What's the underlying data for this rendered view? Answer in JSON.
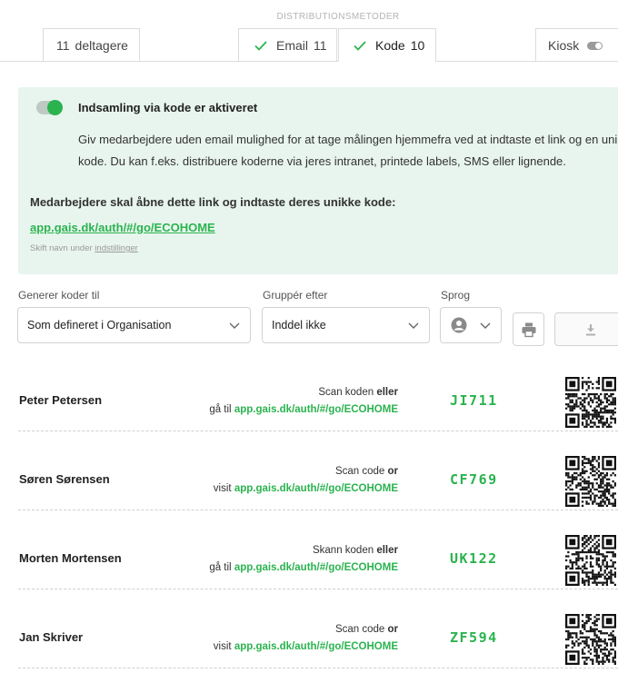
{
  "distribution": {
    "label": "DISTRIBUTIONSMETODER",
    "tabs": [
      {
        "label": "deltagere",
        "count": "11"
      },
      {
        "label": "Email",
        "count": "11"
      },
      {
        "label": "Kode",
        "count": "10"
      },
      {
        "label": "Kiosk"
      }
    ]
  },
  "panel": {
    "title": "Indsamling via kode er aktiveret",
    "description": "Giv medarbejdere uden email mulighed for at tage målingen hjemmefra ved at indtaste et link og en unik kode. Du kan f.eks. distribuere koderne via jeres intranet, printede labels, SMS eller lignende.",
    "instruction": "Medarbejdere skal åbne dette link og indtaste deres unikke kode:",
    "link": "app.gais.dk/auth/#/go/ECOHOME",
    "note_prefix": "Skift navn under",
    "note_link": "indstillinger"
  },
  "filters": {
    "generate_label": "Generer koder til",
    "generate_value": "Som defineret i Organisation",
    "group_label": "Gruppér efter",
    "group_value": "Inddel ikke",
    "language_label": "Sprog"
  },
  "people": [
    {
      "name": "Peter Petersen",
      "scan": "Scan koden",
      "or": "eller",
      "visit": "gå til",
      "url": "app.gais.dk/auth/#/go/ECOHOME",
      "code": "JI711"
    },
    {
      "name": "Søren Sørensen",
      "scan": "Scan code",
      "or": "or",
      "visit": "visit",
      "url": "app.gais.dk/auth/#/go/ECOHOME",
      "code": "CF769"
    },
    {
      "name": "Morten Mortensen",
      "scan": "Skann koden",
      "or": "eller",
      "visit": "gå til",
      "url": "app.gais.dk/auth/#/go/ECOHOME",
      "code": "UK122"
    },
    {
      "name": "Jan Skriver",
      "scan": "Scan code",
      "or": "or",
      "visit": "visit",
      "url": "app.gais.dk/auth/#/go/ECOHOME",
      "code": "ZF594"
    }
  ],
  "colors": {
    "accent": "#2bb34f",
    "panel_bg": "#e8f5ee"
  }
}
